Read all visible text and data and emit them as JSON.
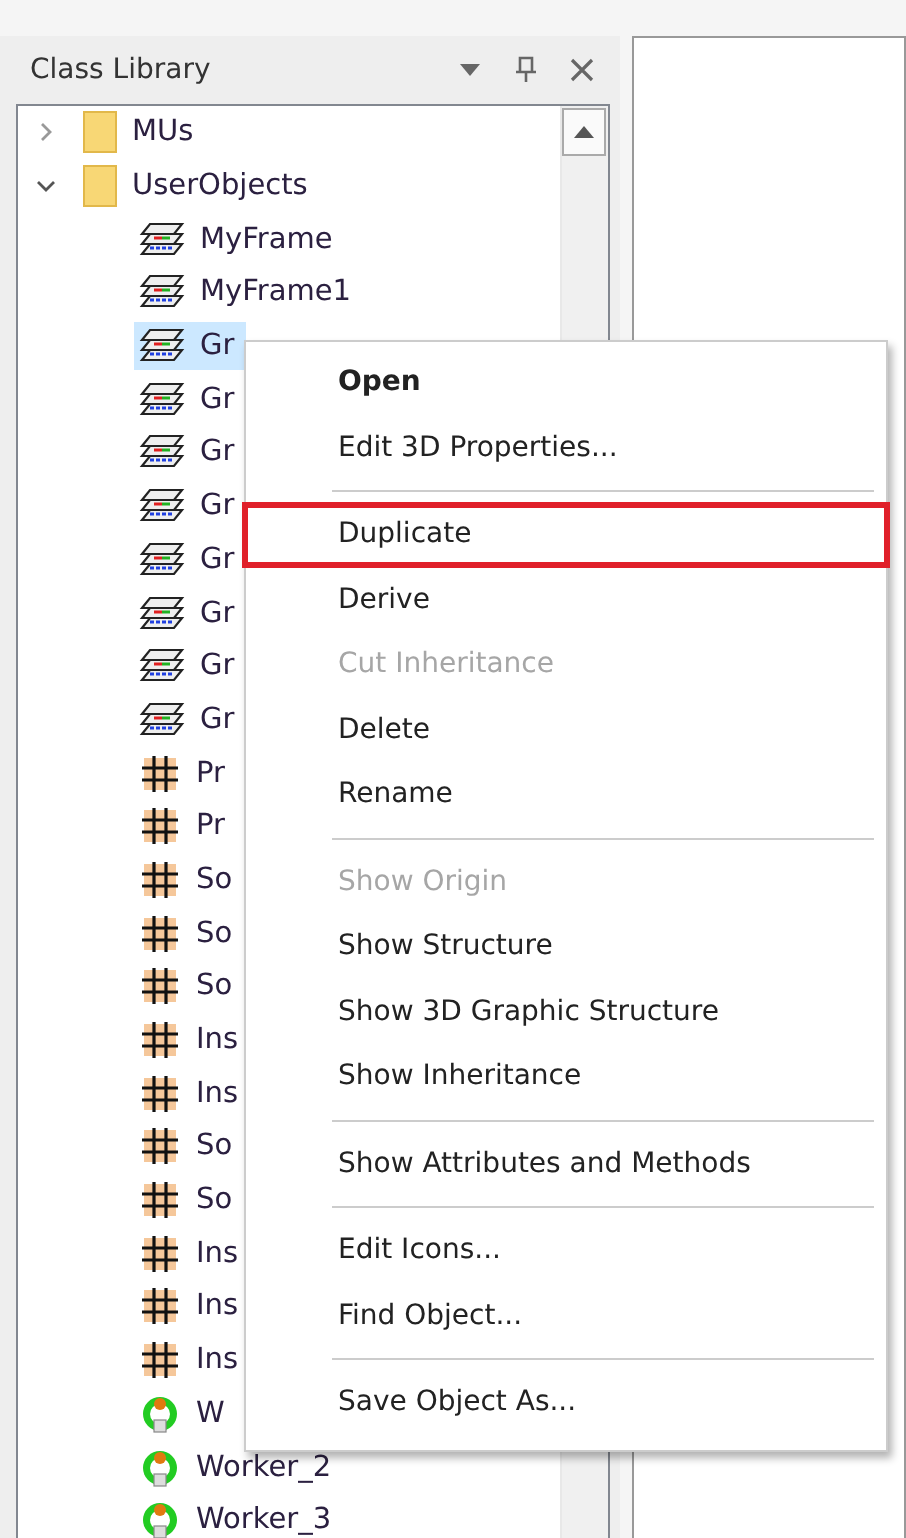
{
  "panel": {
    "title": "Class Library"
  },
  "tree": [
    {
      "label": "MUs",
      "kind": "folder",
      "expanded": false,
      "selected": false
    },
    {
      "label": "UserObjects",
      "kind": "folder",
      "expanded": true,
      "selected": false,
      "children": [
        {
          "label": "MyFrame",
          "kind": "frame",
          "selected": false
        },
        {
          "label": "MyFrame1",
          "kind": "frame",
          "selected": false
        },
        {
          "label": "Gr",
          "kind": "frame",
          "selected": true
        },
        {
          "label": "Gr",
          "kind": "frame",
          "selected": false
        },
        {
          "label": "Gr",
          "kind": "frame",
          "selected": false
        },
        {
          "label": "Gr",
          "kind": "frame",
          "selected": false
        },
        {
          "label": "Gr",
          "kind": "frame",
          "selected": false
        },
        {
          "label": "Gr",
          "kind": "frame",
          "selected": false
        },
        {
          "label": "Gr",
          "kind": "frame",
          "selected": false
        },
        {
          "label": "Gr",
          "kind": "frame",
          "selected": false
        },
        {
          "label": "Pr",
          "kind": "grid",
          "selected": false
        },
        {
          "label": "Pr",
          "kind": "grid",
          "selected": false
        },
        {
          "label": "So",
          "kind": "grid",
          "selected": false
        },
        {
          "label": "So",
          "kind": "grid",
          "selected": false
        },
        {
          "label": "So",
          "kind": "grid",
          "selected": false
        },
        {
          "label": "Ins",
          "kind": "grid",
          "selected": false
        },
        {
          "label": "Ins",
          "kind": "grid",
          "selected": false
        },
        {
          "label": "So",
          "kind": "grid",
          "selected": false
        },
        {
          "label": "So",
          "kind": "grid",
          "selected": false
        },
        {
          "label": "Ins",
          "kind": "grid",
          "selected": false
        },
        {
          "label": "Ins",
          "kind": "grid",
          "selected": false
        },
        {
          "label": "Ins",
          "kind": "grid",
          "selected": false
        },
        {
          "label": "W",
          "kind": "worker",
          "selected": false
        },
        {
          "label": "Worker_2",
          "kind": "worker",
          "selected": false
        },
        {
          "label": "Worker_3",
          "kind": "worker",
          "selected": false
        }
      ]
    }
  ],
  "context_menu": [
    {
      "kind": "item",
      "label": "Open",
      "default": true,
      "disabled": false,
      "highlighted": false
    },
    {
      "kind": "item",
      "label": "Edit 3D Properties...",
      "default": false,
      "disabled": false,
      "highlighted": false
    },
    {
      "kind": "separator"
    },
    {
      "kind": "item",
      "label": "Duplicate",
      "default": false,
      "disabled": false,
      "highlighted": true
    },
    {
      "kind": "item",
      "label": "Derive",
      "default": false,
      "disabled": false,
      "highlighted": false
    },
    {
      "kind": "item",
      "label": "Cut Inheritance",
      "default": false,
      "disabled": true,
      "highlighted": false
    },
    {
      "kind": "item",
      "label": "Delete",
      "default": false,
      "disabled": false,
      "highlighted": false
    },
    {
      "kind": "item",
      "label": "Rename",
      "default": false,
      "disabled": false,
      "highlighted": false
    },
    {
      "kind": "separator"
    },
    {
      "kind": "item",
      "label": "Show Origin",
      "default": false,
      "disabled": true,
      "highlighted": false
    },
    {
      "kind": "item",
      "label": "Show Structure",
      "default": false,
      "disabled": false,
      "highlighted": false
    },
    {
      "kind": "item",
      "label": "Show 3D Graphic Structure",
      "default": false,
      "disabled": false,
      "highlighted": false
    },
    {
      "kind": "item",
      "label": "Show Inheritance",
      "default": false,
      "disabled": false,
      "highlighted": false
    },
    {
      "kind": "separator"
    },
    {
      "kind": "item",
      "label": "Show Attributes and Methods",
      "default": false,
      "disabled": false,
      "highlighted": false
    },
    {
      "kind": "separator"
    },
    {
      "kind": "item",
      "label": "Edit Icons...",
      "default": false,
      "disabled": false,
      "highlighted": false
    },
    {
      "kind": "item",
      "label": "Find Object...",
      "default": false,
      "disabled": false,
      "highlighted": false
    },
    {
      "kind": "separator"
    },
    {
      "kind": "item",
      "label": "Save Object As...",
      "default": false,
      "disabled": false,
      "highlighted": false
    }
  ]
}
